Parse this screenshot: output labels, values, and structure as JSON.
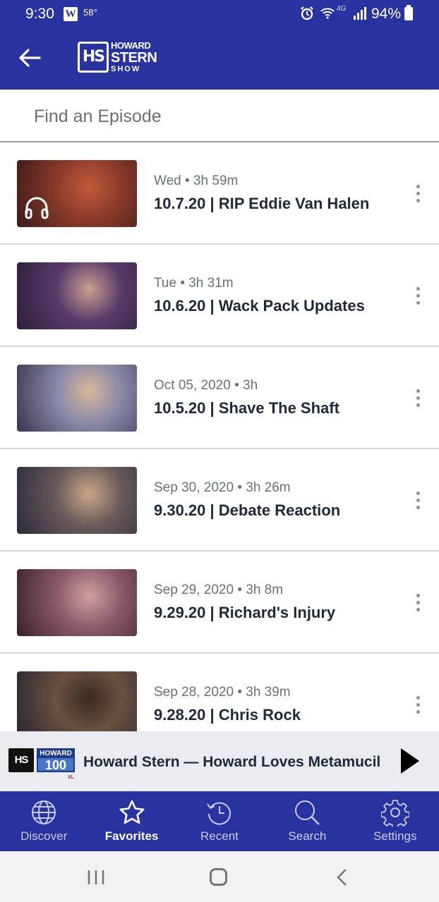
{
  "status_bar": {
    "time": "9:30",
    "weather_badge": "W",
    "temperature": "58°",
    "network": "4G",
    "battery": "94%"
  },
  "header": {
    "back_icon": "arrow-left-icon",
    "logo": {
      "line1": "HOWARD",
      "line2": "STERN",
      "line3": "SHOW"
    }
  },
  "search": {
    "placeholder": "Find an Episode",
    "value": ""
  },
  "episodes": [
    {
      "meta": "Wed • 3h 59m",
      "title": "10.7.20 | RIP Eddie Van Halen",
      "thumb_colors": [
        "#3b1a1a",
        "#8a3a2a",
        "#c25a3a"
      ],
      "has_headphones": true
    },
    {
      "meta": "Tue • 3h 31m",
      "title": "10.6.20 | Wack Pack Updates",
      "thumb_colors": [
        "#2a1f3a",
        "#5a3a6a",
        "#c8a090"
      ]
    },
    {
      "meta": "Oct 05, 2020 • 3h",
      "title": "10.5.20 | Shave The Shaft",
      "thumb_colors": [
        "#3a3550",
        "#8888a8",
        "#d9b89a"
      ]
    },
    {
      "meta": "Sep 30, 2020 • 3h 26m",
      "title": "9.30.20 | Debate Reaction",
      "thumb_colors": [
        "#2a2a3a",
        "#6a5a5a",
        "#c9a68a"
      ]
    },
    {
      "meta": "Sep 29, 2020 • 3h 8m",
      "title": "9.29.20 | Richard's Injury",
      "thumb_colors": [
        "#3a1f2a",
        "#8a5a6a",
        "#d0a0a0"
      ]
    },
    {
      "meta": "Sep 28, 2020 • 3h 39m",
      "title": "9.28.20 | Chris Rock",
      "thumb_colors": [
        "#2a2530",
        "#6a5040",
        "#3a2a20"
      ]
    }
  ],
  "player": {
    "logo": {
      "hs": "HS",
      "top": "HOWARD",
      "num": "100",
      "xl": "XL"
    },
    "now_playing": "Howard Stern — Howard Loves Metamucil",
    "play_icon": "play-icon"
  },
  "bottom_nav": {
    "items": [
      {
        "label": "Discover",
        "icon": "globe-icon"
      },
      {
        "label": "Favorites",
        "icon": "star-icon",
        "active": true
      },
      {
        "label": "Recent",
        "icon": "history-icon"
      },
      {
        "label": "Search",
        "icon": "search-icon"
      },
      {
        "label": "Settings",
        "icon": "gear-icon"
      }
    ]
  },
  "colors": {
    "brand_blue": "#2833a0",
    "text_dark": "#1f2937",
    "text_muted": "#6b7075"
  }
}
